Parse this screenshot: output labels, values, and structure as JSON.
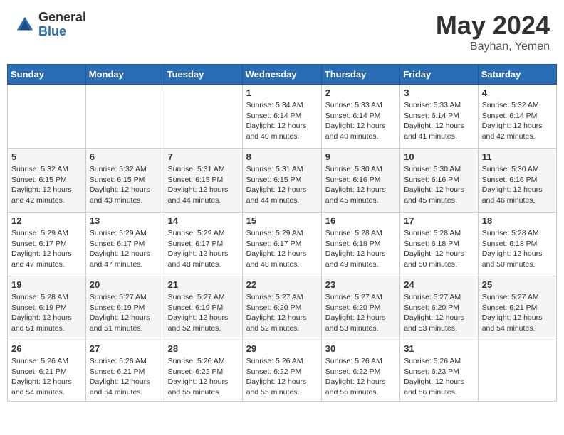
{
  "logo": {
    "general": "General",
    "blue": "Blue"
  },
  "title": "May 2024",
  "location": "Bayhan, Yemen",
  "days_header": [
    "Sunday",
    "Monday",
    "Tuesday",
    "Wednesday",
    "Thursday",
    "Friday",
    "Saturday"
  ],
  "weeks": [
    [
      {
        "num": "",
        "info": ""
      },
      {
        "num": "",
        "info": ""
      },
      {
        "num": "",
        "info": ""
      },
      {
        "num": "1",
        "info": "Sunrise: 5:34 AM\nSunset: 6:14 PM\nDaylight: 12 hours\nand 40 minutes."
      },
      {
        "num": "2",
        "info": "Sunrise: 5:33 AM\nSunset: 6:14 PM\nDaylight: 12 hours\nand 40 minutes."
      },
      {
        "num": "3",
        "info": "Sunrise: 5:33 AM\nSunset: 6:14 PM\nDaylight: 12 hours\nand 41 minutes."
      },
      {
        "num": "4",
        "info": "Sunrise: 5:32 AM\nSunset: 6:14 PM\nDaylight: 12 hours\nand 42 minutes."
      }
    ],
    [
      {
        "num": "5",
        "info": "Sunrise: 5:32 AM\nSunset: 6:15 PM\nDaylight: 12 hours\nand 42 minutes."
      },
      {
        "num": "6",
        "info": "Sunrise: 5:32 AM\nSunset: 6:15 PM\nDaylight: 12 hours\nand 43 minutes."
      },
      {
        "num": "7",
        "info": "Sunrise: 5:31 AM\nSunset: 6:15 PM\nDaylight: 12 hours\nand 44 minutes."
      },
      {
        "num": "8",
        "info": "Sunrise: 5:31 AM\nSunset: 6:15 PM\nDaylight: 12 hours\nand 44 minutes."
      },
      {
        "num": "9",
        "info": "Sunrise: 5:30 AM\nSunset: 6:16 PM\nDaylight: 12 hours\nand 45 minutes."
      },
      {
        "num": "10",
        "info": "Sunrise: 5:30 AM\nSunset: 6:16 PM\nDaylight: 12 hours\nand 45 minutes."
      },
      {
        "num": "11",
        "info": "Sunrise: 5:30 AM\nSunset: 6:16 PM\nDaylight: 12 hours\nand 46 minutes."
      }
    ],
    [
      {
        "num": "12",
        "info": "Sunrise: 5:29 AM\nSunset: 6:17 PM\nDaylight: 12 hours\nand 47 minutes."
      },
      {
        "num": "13",
        "info": "Sunrise: 5:29 AM\nSunset: 6:17 PM\nDaylight: 12 hours\nand 47 minutes."
      },
      {
        "num": "14",
        "info": "Sunrise: 5:29 AM\nSunset: 6:17 PM\nDaylight: 12 hours\nand 48 minutes."
      },
      {
        "num": "15",
        "info": "Sunrise: 5:29 AM\nSunset: 6:17 PM\nDaylight: 12 hours\nand 48 minutes."
      },
      {
        "num": "16",
        "info": "Sunrise: 5:28 AM\nSunset: 6:18 PM\nDaylight: 12 hours\nand 49 minutes."
      },
      {
        "num": "17",
        "info": "Sunrise: 5:28 AM\nSunset: 6:18 PM\nDaylight: 12 hours\nand 50 minutes."
      },
      {
        "num": "18",
        "info": "Sunrise: 5:28 AM\nSunset: 6:18 PM\nDaylight: 12 hours\nand 50 minutes."
      }
    ],
    [
      {
        "num": "19",
        "info": "Sunrise: 5:28 AM\nSunset: 6:19 PM\nDaylight: 12 hours\nand 51 minutes."
      },
      {
        "num": "20",
        "info": "Sunrise: 5:27 AM\nSunset: 6:19 PM\nDaylight: 12 hours\nand 51 minutes."
      },
      {
        "num": "21",
        "info": "Sunrise: 5:27 AM\nSunset: 6:19 PM\nDaylight: 12 hours\nand 52 minutes."
      },
      {
        "num": "22",
        "info": "Sunrise: 5:27 AM\nSunset: 6:20 PM\nDaylight: 12 hours\nand 52 minutes."
      },
      {
        "num": "23",
        "info": "Sunrise: 5:27 AM\nSunset: 6:20 PM\nDaylight: 12 hours\nand 53 minutes."
      },
      {
        "num": "24",
        "info": "Sunrise: 5:27 AM\nSunset: 6:20 PM\nDaylight: 12 hours\nand 53 minutes."
      },
      {
        "num": "25",
        "info": "Sunrise: 5:27 AM\nSunset: 6:21 PM\nDaylight: 12 hours\nand 54 minutes."
      }
    ],
    [
      {
        "num": "26",
        "info": "Sunrise: 5:26 AM\nSunset: 6:21 PM\nDaylight: 12 hours\nand 54 minutes."
      },
      {
        "num": "27",
        "info": "Sunrise: 5:26 AM\nSunset: 6:21 PM\nDaylight: 12 hours\nand 54 minutes."
      },
      {
        "num": "28",
        "info": "Sunrise: 5:26 AM\nSunset: 6:22 PM\nDaylight: 12 hours\nand 55 minutes."
      },
      {
        "num": "29",
        "info": "Sunrise: 5:26 AM\nSunset: 6:22 PM\nDaylight: 12 hours\nand 55 minutes."
      },
      {
        "num": "30",
        "info": "Sunrise: 5:26 AM\nSunset: 6:22 PM\nDaylight: 12 hours\nand 56 minutes."
      },
      {
        "num": "31",
        "info": "Sunrise: 5:26 AM\nSunset: 6:23 PM\nDaylight: 12 hours\nand 56 minutes."
      },
      {
        "num": "",
        "info": ""
      }
    ]
  ]
}
